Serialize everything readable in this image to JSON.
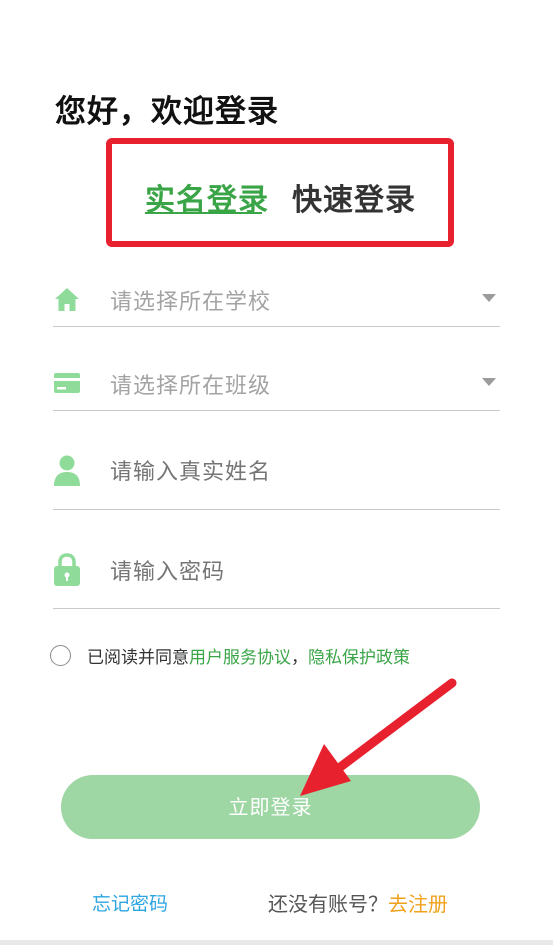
{
  "greeting": "您好，欢迎登录",
  "tabs": [
    {
      "label": "实名登录",
      "active": true
    },
    {
      "label": "快速登录",
      "active": false
    }
  ],
  "fields": {
    "school": {
      "placeholder": "请选择所在学校",
      "icon": "home-icon"
    },
    "class": {
      "placeholder": "请选择所在班级",
      "icon": "card-icon"
    },
    "name": {
      "placeholder": "请输入真实姓名",
      "icon": "user-icon"
    },
    "password": {
      "placeholder": "请输入密码",
      "icon": "lock-icon"
    }
  },
  "agreement": {
    "prefix": "已阅读并同意",
    "user_agreement": "用户服务协议",
    "separator": "，",
    "privacy_policy": "隐私保护政策",
    "checked": false
  },
  "login_button": "立即登录",
  "footer": {
    "forgot_password": "忘记密码",
    "no_account": "还没有账号？",
    "register": "去注册"
  },
  "colors": {
    "accent_green": "#3aa547",
    "icon_green": "#8fdc9a",
    "button_green": "#9ed6a4",
    "annotation_red": "#e8212f",
    "link_blue": "#2da5e1",
    "register_orange": "#f0a21b"
  }
}
